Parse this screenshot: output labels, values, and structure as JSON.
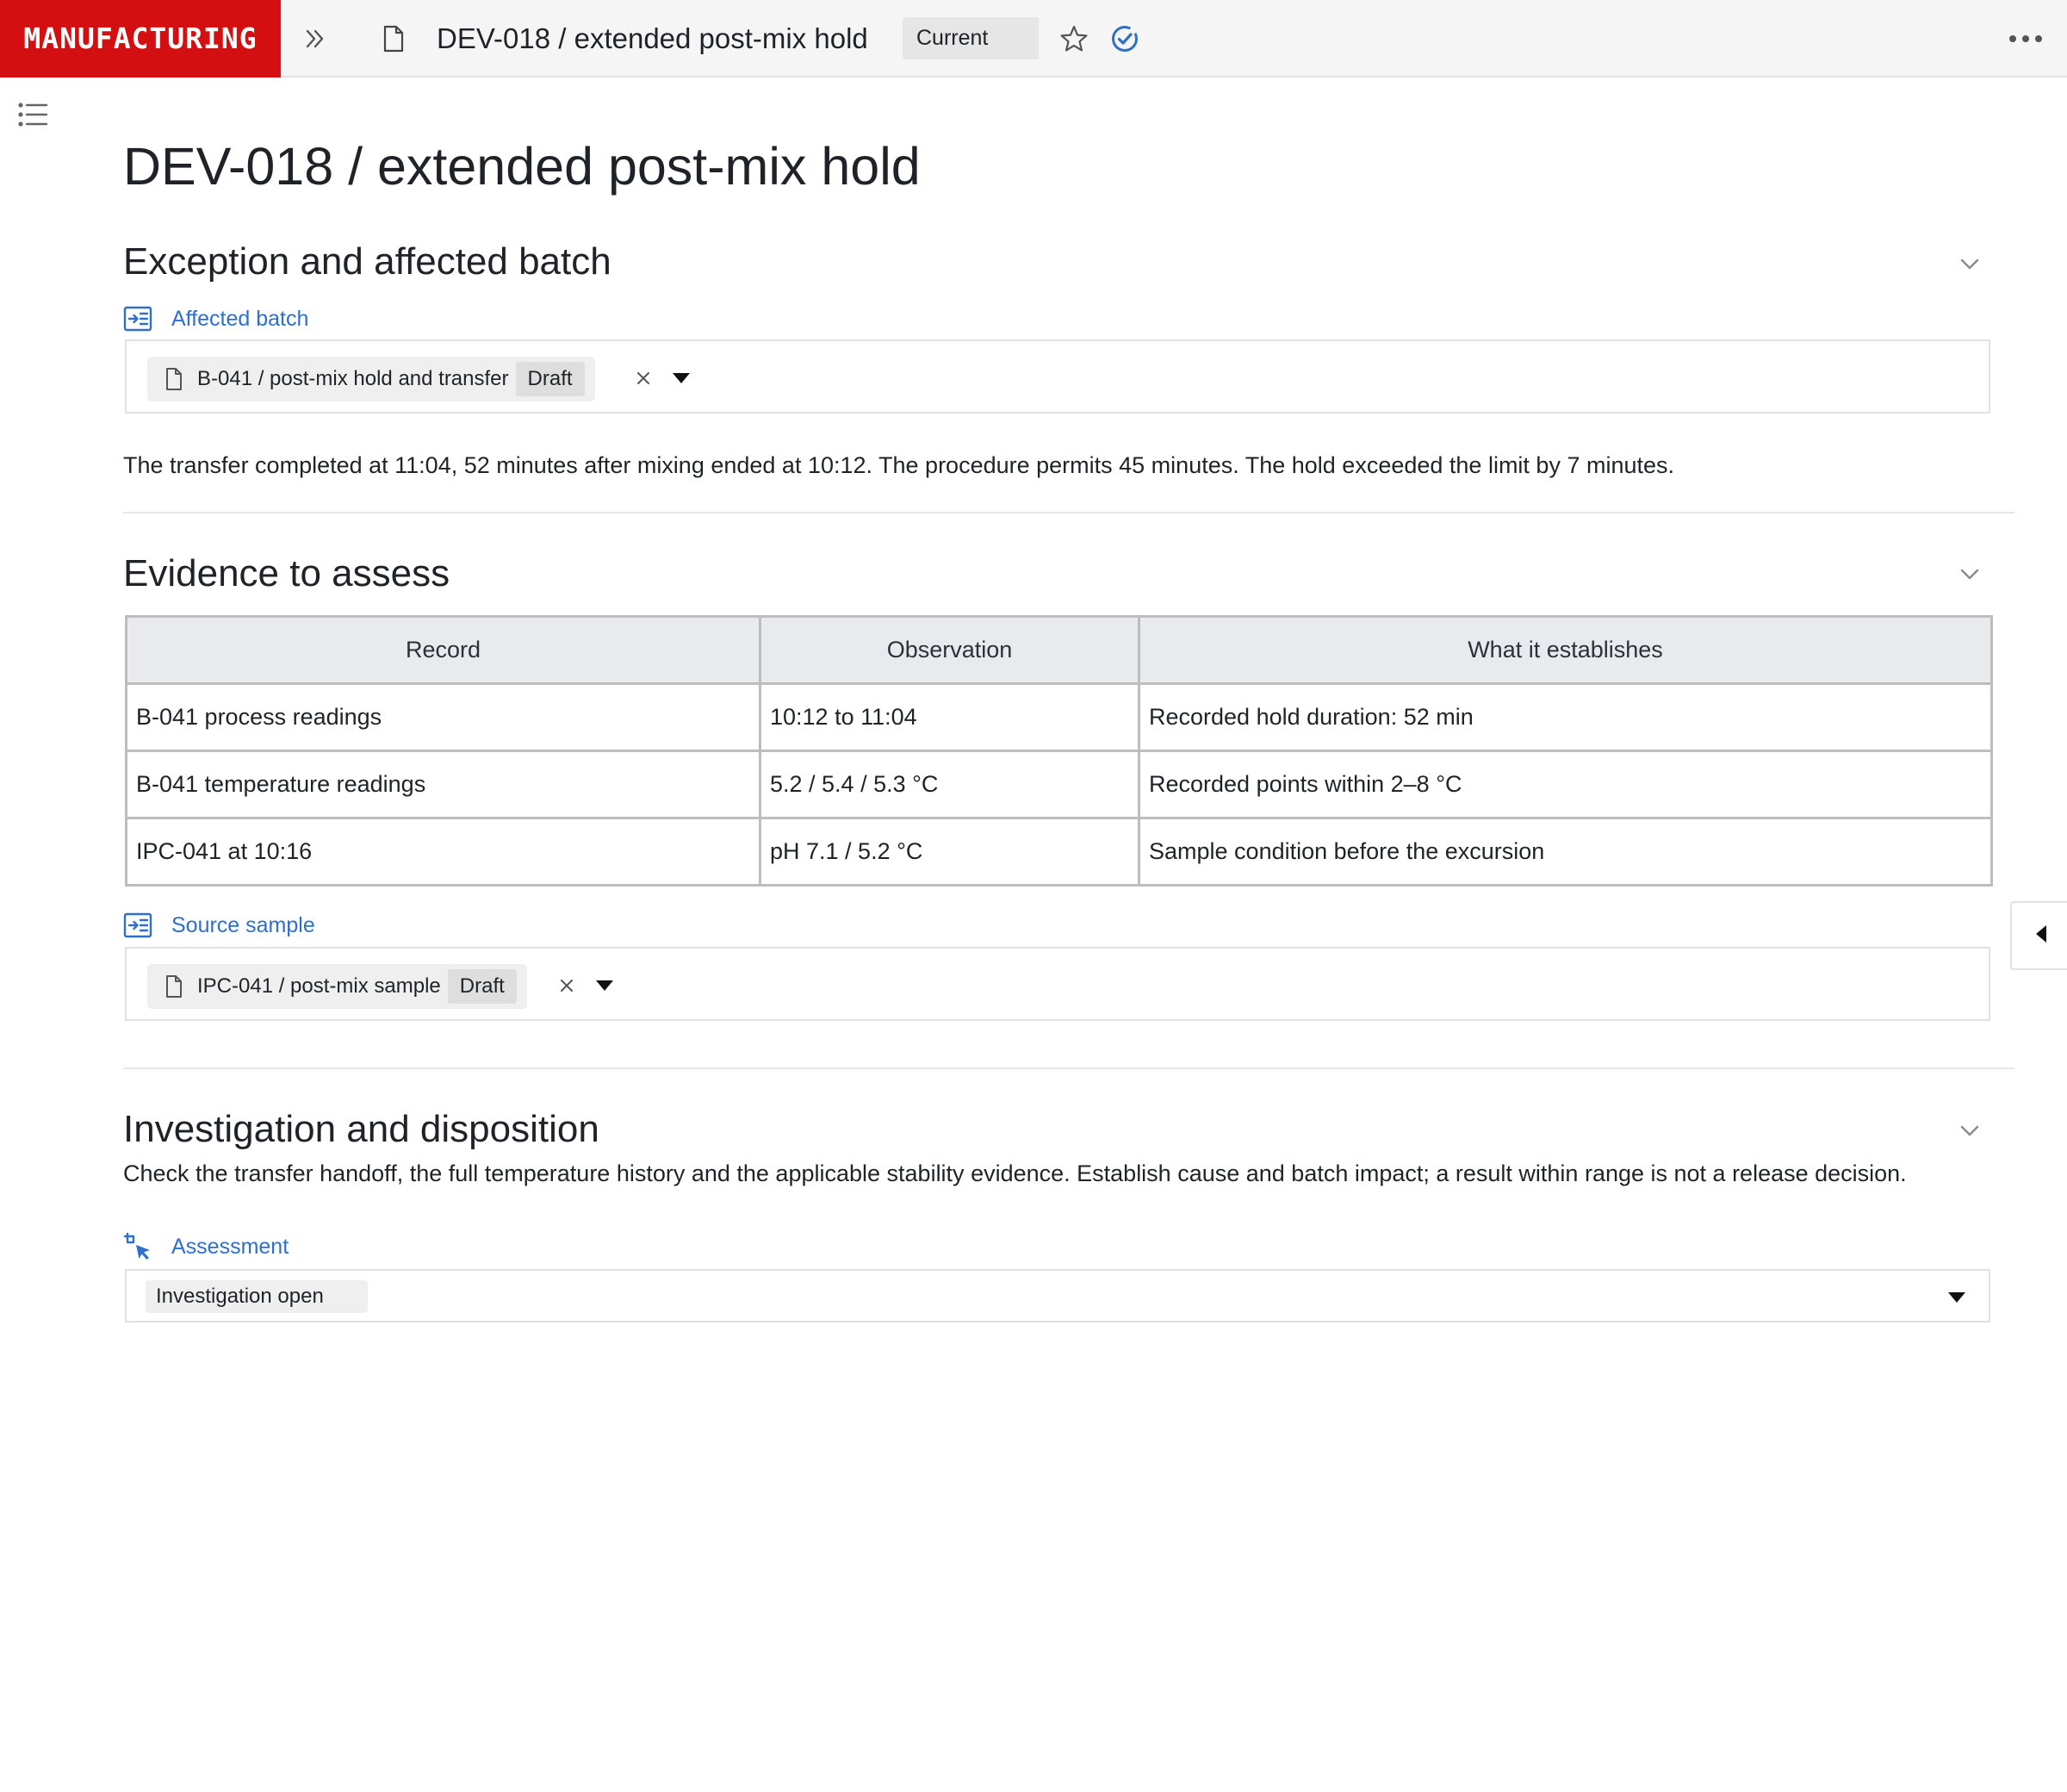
{
  "brand": {
    "label": "MANUFACTURING",
    "color": "#d40f12"
  },
  "topbar": {
    "title": "DEV-018 / extended post-mix hold",
    "status": "Current",
    "icons": [
      "double-chevron-right-icon",
      "document-icon",
      "star-icon",
      "verified-check-icon",
      "more-horizontal-icon"
    ]
  },
  "page": {
    "title": "DEV-018 / extended post-mix hold"
  },
  "sections": {
    "exception": {
      "heading": "Exception and affected batch",
      "field_label": "Affected batch",
      "ref": {
        "text": "B-041 / post-mix hold and transfer",
        "badge": "Draft"
      },
      "paragraph": "The transfer completed at 11:04, 52 minutes after mixing ended at 10:12. The procedure permits 45 minutes. The hold exceeded the limit by 7 minutes."
    },
    "evidence": {
      "heading": "Evidence to assess",
      "table": {
        "headers": [
          "Record",
          "Observation",
          "What it establishes"
        ],
        "rows": [
          [
            "B-041 process readings",
            "10:12 to 11:04",
            "Recorded hold duration: 52 min"
          ],
          [
            "B-041 temperature readings",
            "5.2 / 5.4 / 5.3 °C",
            "Recorded points within 2–8 °C"
          ],
          [
            "IPC-041 at 10:16",
            "pH 7.1 / 5.2 °C",
            "Sample condition before the excursion"
          ]
        ]
      },
      "field_label": "Source sample",
      "ref": {
        "text": "IPC-041 / post-mix sample",
        "badge": "Draft"
      }
    },
    "investigation": {
      "heading": "Investigation and disposition",
      "paragraph": "Check the transfer handoff, the full temperature history and the applicable stability evidence. Establish cause and batch impact; a result within range is not a release decision.",
      "field_label": "Assessment",
      "select_value": "Investigation open"
    }
  },
  "colors": {
    "accent_link": "#2f6fca",
    "verified": "#2f6fca",
    "table_header_bg": "#e9eaed"
  }
}
